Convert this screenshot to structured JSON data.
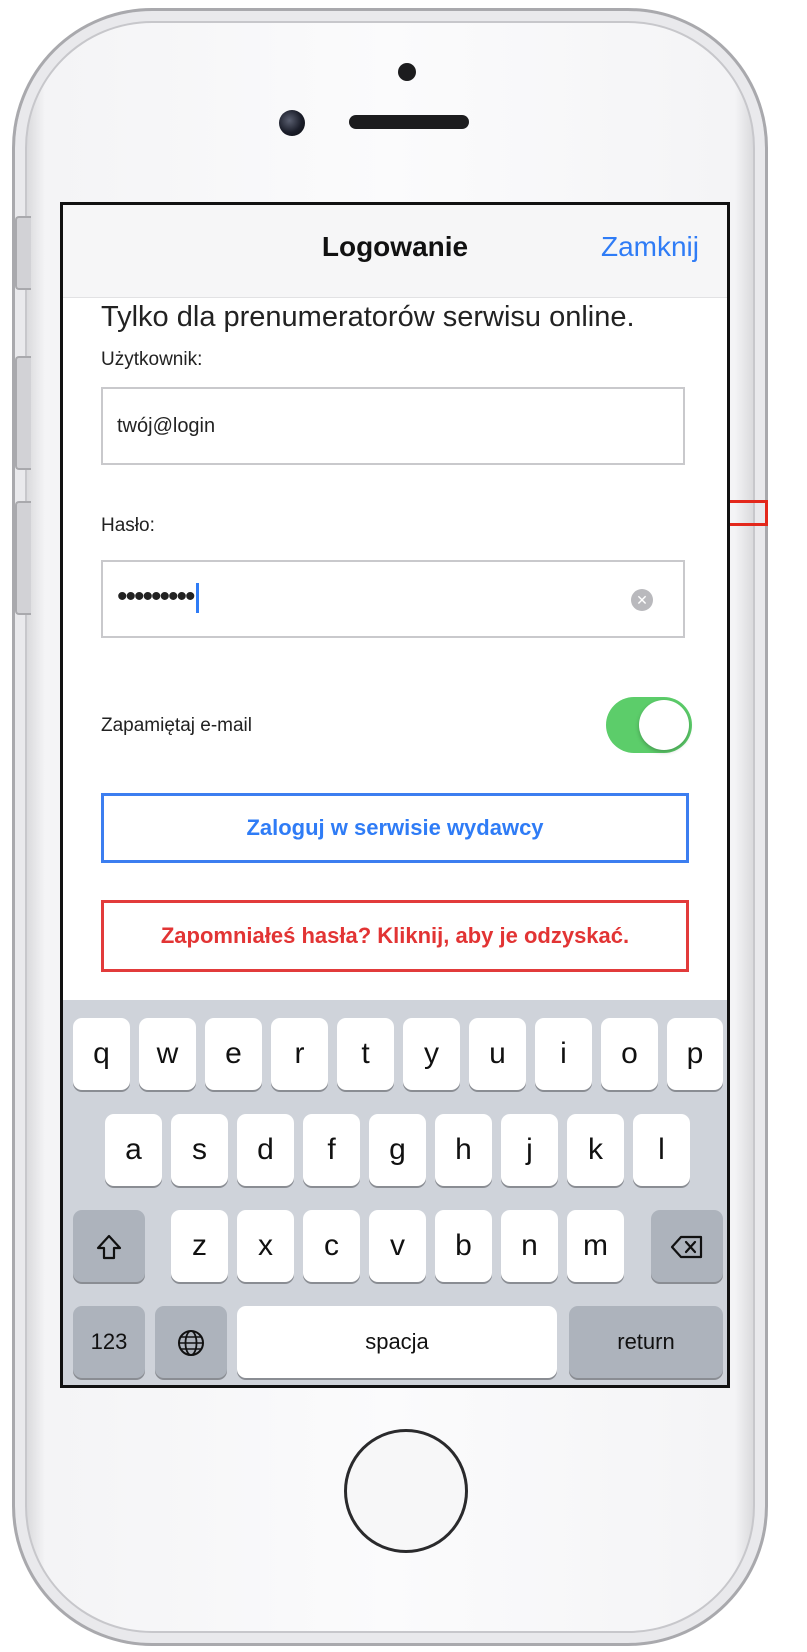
{
  "navbar": {
    "title": "Logowanie",
    "close_label": "Zamknij"
  },
  "form": {
    "intro": "Tylko dla prenumeratorów serwisu online.",
    "username_label": "Użytkownik:",
    "username_value": "twój@login",
    "password_label": "Hasło:",
    "password_value": "•••••••••",
    "remember_label": "Zapamiętaj e-mail",
    "remember_on": true,
    "login_button": "Zaloguj w serwisie wydawcy",
    "forgot_button": "Zapomniałeś hasła? Kliknij, aby je odzyskać."
  },
  "keyboard": {
    "row1": [
      "q",
      "w",
      "e",
      "r",
      "t",
      "y",
      "u",
      "i",
      "o",
      "p"
    ],
    "row2": [
      "a",
      "s",
      "d",
      "f",
      "g",
      "h",
      "j",
      "k",
      "l"
    ],
    "row3": [
      "z",
      "x",
      "c",
      "v",
      "b",
      "n",
      "m"
    ],
    "numbers_label": "123",
    "space_label": "spacja",
    "return_label": "return",
    "icons": {
      "shift": "shift-icon",
      "delete": "backspace-icon",
      "globe": "globe-icon"
    }
  },
  "colors": {
    "accent": "#2f7cf6",
    "toggle_on": "#5ccd6a",
    "danger": "#e23434",
    "keyboard_bg": "#cfd3da"
  }
}
